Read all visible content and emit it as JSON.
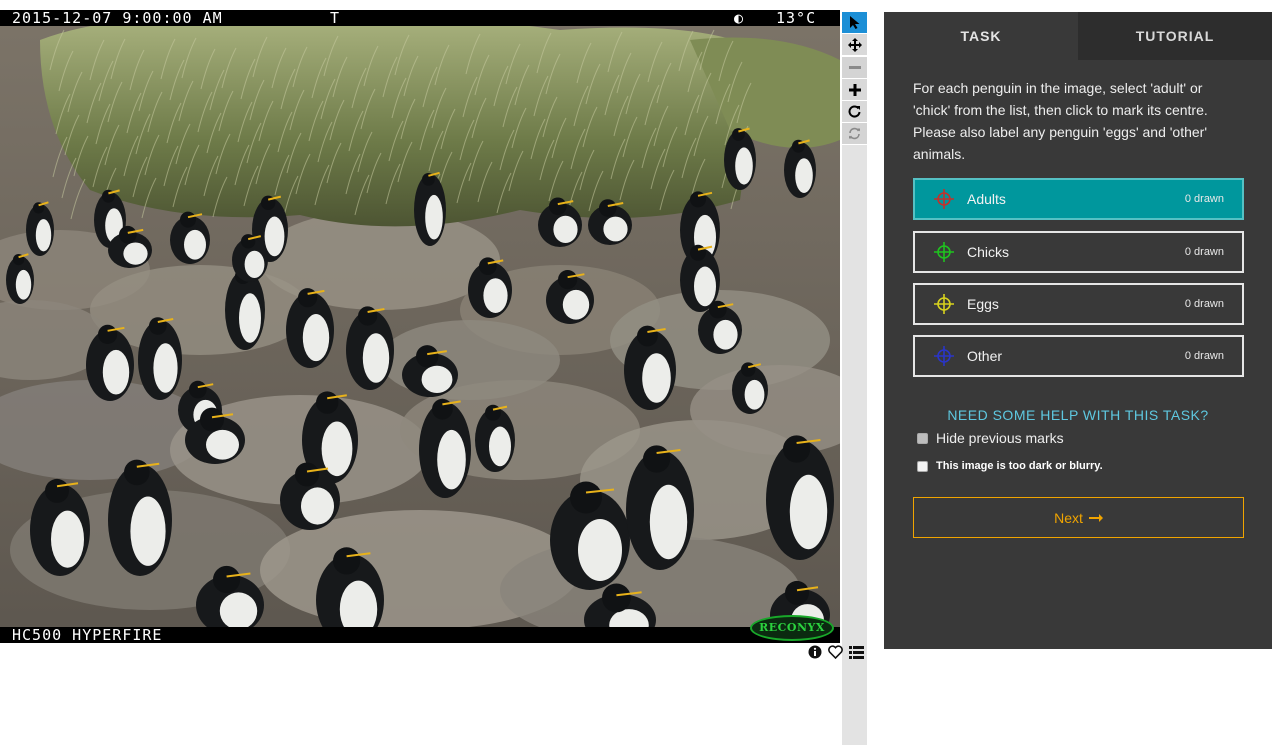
{
  "camera": {
    "timestamp": "2015-12-07 9:00:00 AM",
    "flag": "T",
    "moon": "◐",
    "temperature": "13°C",
    "model": "HC500 HYPERFIRE",
    "brand": "RECONYX"
  },
  "toolbar": {
    "tools": [
      "select",
      "pan",
      "zoom-out",
      "zoom-in",
      "rotate",
      "reset"
    ]
  },
  "tabs": {
    "task": "TASK",
    "tutorial": "TUTORIAL"
  },
  "task": {
    "instructions": "For each penguin in the image, select 'adult' or 'chick' from the list, then click to mark its centre. Please also label any penguin 'eggs' and 'other' animals.",
    "choices": [
      {
        "label": "Adults",
        "count": "0 drawn",
        "color": "#c4302b"
      },
      {
        "label": "Chicks",
        "count": "0 drawn",
        "color": "#1fc21f"
      },
      {
        "label": "Eggs",
        "count": "0 drawn",
        "color": "#d7d21e"
      },
      {
        "label": "Other",
        "count": "0 drawn",
        "color": "#2a35c8"
      }
    ],
    "help": "NEED SOME HELP WITH THIS TASK?",
    "hide_marks": "Hide previous marks",
    "too_dark": "This image is too dark or blurry.",
    "next": "Next"
  },
  "colors": {
    "accent": "#00979d",
    "panel": "#393939",
    "next": "#f0a400",
    "help": "#5ec8e0"
  }
}
